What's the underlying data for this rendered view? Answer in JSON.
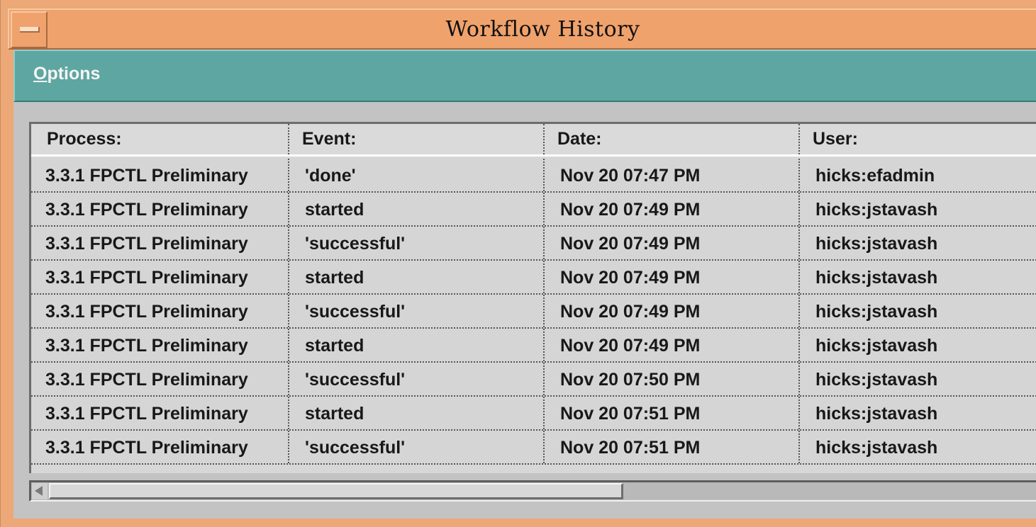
{
  "window": {
    "title": "Workflow History"
  },
  "menubar": {
    "options_mnemonic": "O",
    "options_rest": "ptions"
  },
  "table": {
    "headers": [
      "Process:",
      "Event:",
      "Date:",
      "User:"
    ],
    "rows": [
      [
        "3.3.1 FPCTL Preliminary",
        "'done'",
        "Nov 20 07:47 PM",
        "hicks:efadmin"
      ],
      [
        "3.3.1 FPCTL Preliminary",
        "started",
        "Nov 20 07:49 PM",
        "hicks:jstavash"
      ],
      [
        "3.3.1 FPCTL Preliminary",
        "'successful'",
        "Nov 20 07:49 PM",
        "hicks:jstavash"
      ],
      [
        "3.3.1 FPCTL Preliminary",
        "started",
        "Nov 20 07:49 PM",
        "hicks:jstavash"
      ],
      [
        "3.3.1 FPCTL Preliminary",
        "'successful'",
        "Nov 20 07:49 PM",
        "hicks:jstavash"
      ],
      [
        "3.3.1 FPCTL Preliminary",
        "started",
        "Nov 20 07:49 PM",
        "hicks:jstavash"
      ],
      [
        "3.3.1 FPCTL Preliminary",
        "'successful'",
        "Nov 20 07:50 PM",
        "hicks:jstavash"
      ],
      [
        "3.3.1 FPCTL Preliminary",
        "started",
        "Nov 20 07:51 PM",
        "hicks:jstavash"
      ],
      [
        "3.3.1 FPCTL Preliminary",
        "'successful'",
        "Nov 20 07:51 PM",
        "hicks:jstavash"
      ]
    ]
  },
  "icons": {
    "window_menu": "window-menu-icon",
    "scroll_left": "left-arrow-icon"
  },
  "colors": {
    "title_bar": "#f0a26c",
    "menu_bar": "#5ea6a2",
    "client": "#c3c3c3"
  }
}
